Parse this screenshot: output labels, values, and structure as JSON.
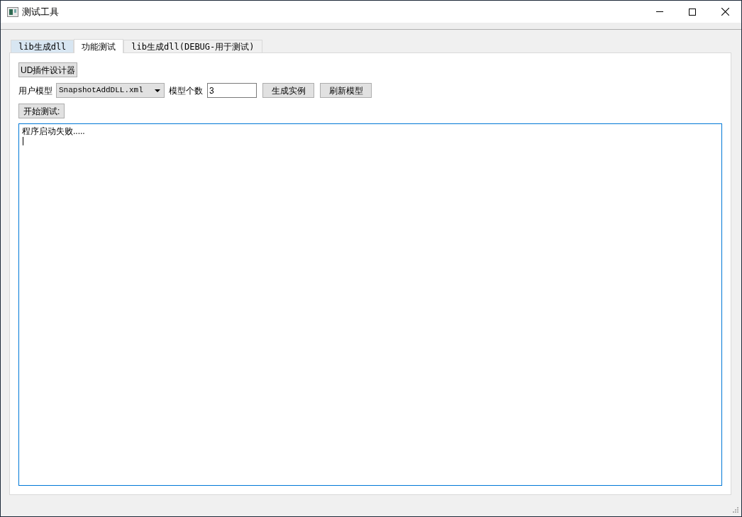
{
  "window": {
    "title": "测试工具"
  },
  "tabs": [
    {
      "label": "lib生成dll",
      "selected": false,
      "hovered": true
    },
    {
      "label": "功能测试",
      "selected": true,
      "hovered": false
    },
    {
      "label": "lib生成dll(DEBUG-用于测试)",
      "selected": false,
      "hovered": false
    }
  ],
  "plugin_button": "UD插件设计器",
  "model": {
    "label": "用户模型",
    "value": "SnapshotAddDLL.xml"
  },
  "count": {
    "label": "模型个数",
    "value": "3"
  },
  "buttons": [
    "生成实例",
    "刷新模型"
  ],
  "start_button": "开始测试:",
  "log": {
    "text": "程序启动失败.....",
    "focused": true
  }
}
